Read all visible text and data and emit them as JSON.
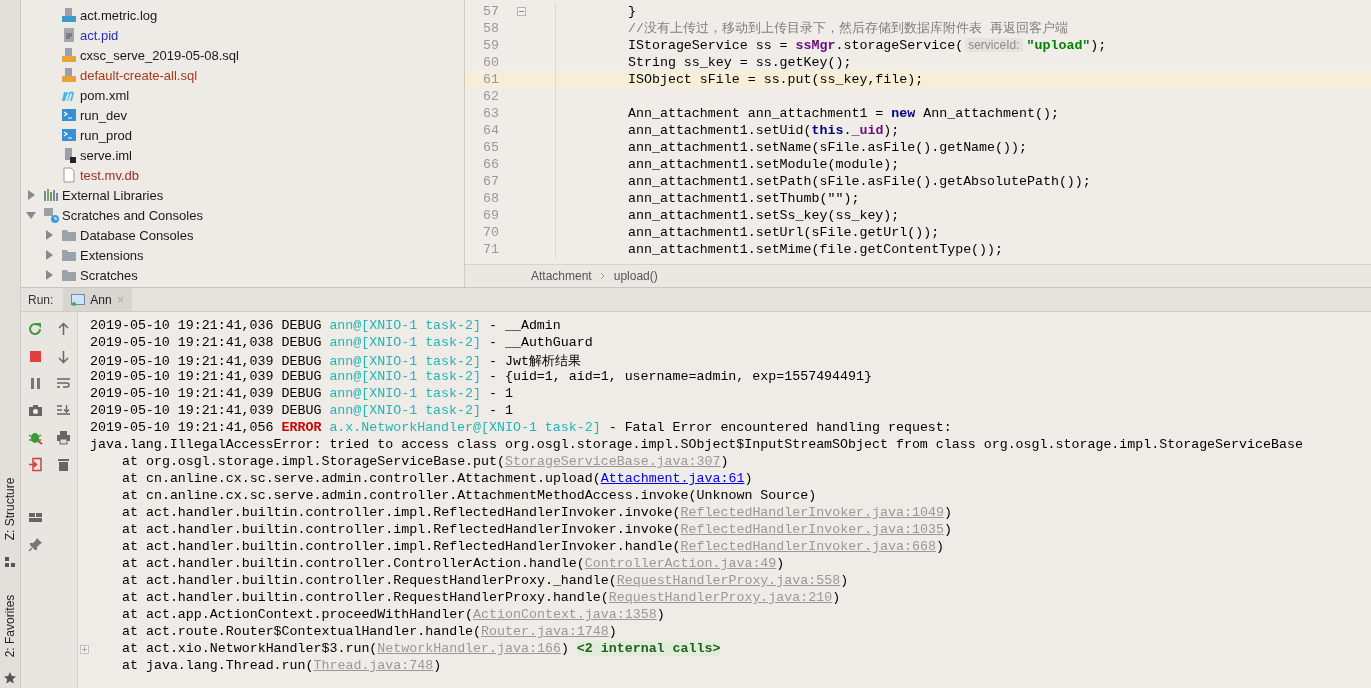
{
  "side_strip": {
    "tabs": [
      {
        "label": "Z: Structure",
        "kind": "structure"
      },
      {
        "label": "2: Favorites",
        "kind": "favorites"
      }
    ]
  },
  "project_tree": {
    "project_files": [
      {
        "label": "act.metric.log",
        "kind": "log",
        "color": "#1a1a1a"
      },
      {
        "label": "act.pid",
        "kind": "text",
        "color": "#2630b8"
      },
      {
        "label": "cxsc_serve_2019-05-08.sql",
        "kind": "sql",
        "color": "#1a1a1a"
      },
      {
        "label": "default-create-all.sql",
        "kind": "sql",
        "color": "#a8391c"
      },
      {
        "label": "pom.xml",
        "kind": "maven",
        "color": "#1a1a1a"
      },
      {
        "label": "run_dev",
        "kind": "shell",
        "color": "#1a1a1a"
      },
      {
        "label": "run_prod",
        "kind": "shell",
        "color": "#1a1a1a"
      },
      {
        "label": "serve.iml",
        "kind": "module",
        "color": "#1a1a1a"
      },
      {
        "label": "test.mv.db",
        "kind": "file",
        "color": "#9c2b2b"
      }
    ],
    "nodes": [
      {
        "label": "External Libraries",
        "kind": "libraries",
        "expanded": false,
        "color": "#1a1a1a"
      },
      {
        "label": "Scratches and Consoles",
        "kind": "scratches",
        "expanded": true,
        "color": "#1a1a1a",
        "children": [
          {
            "label": "Database Consoles",
            "kind": "folder",
            "expanded": false,
            "color": "#1a1a1a"
          },
          {
            "label": "Extensions",
            "kind": "folder",
            "expanded": false,
            "color": "#1a1a1a"
          },
          {
            "label": "Scratches",
            "kind": "folder",
            "expanded": false,
            "color": "#1a1a1a"
          }
        ]
      }
    ]
  },
  "editor": {
    "lines": [
      {
        "number": "57",
        "current": false,
        "fold": true,
        "segments": [
          {
            "text": "}",
            "kind": "plain"
          }
        ]
      },
      {
        "number": "58",
        "current": false,
        "fold": false,
        "segments": [
          {
            "text": "//没有上传过，移动到上传目录下，然后存储到数据库附件表 再返回客户端",
            "kind": "comment"
          }
        ]
      },
      {
        "number": "59",
        "current": false,
        "fold": false,
        "segments": [
          {
            "text": "IStorageService ss = ",
            "kind": "plain"
          },
          {
            "text": "ssMgr",
            "kind": "field"
          },
          {
            "text": ".storageService(",
            "kind": "plain"
          },
          {
            "text": "serviceId:",
            "kind": "hint"
          },
          {
            "text": "\"upload\"",
            "kind": "string"
          },
          {
            "text": ");",
            "kind": "plain"
          }
        ]
      },
      {
        "number": "60",
        "current": false,
        "fold": false,
        "segments": [
          {
            "text": "String ss_key = ss.getKey();",
            "kind": "plain"
          }
        ]
      },
      {
        "number": "61",
        "current": true,
        "fold": false,
        "segments": [
          {
            "text": "ISObject sFile = ss.put(ss_key,file);",
            "kind": "plain"
          }
        ]
      },
      {
        "number": "62",
        "current": false,
        "fold": false
      },
      {
        "number": "63",
        "current": false,
        "fold": false,
        "segments": [
          {
            "text": "Ann_attachment ann_attachment1 = ",
            "kind": "plain"
          },
          {
            "text": "new",
            "kind": "keyword"
          },
          {
            "text": " Ann_attachment();",
            "kind": "plain"
          }
        ]
      },
      {
        "number": "64",
        "current": false,
        "fold": false,
        "segments": [
          {
            "text": "ann_attachment1.setUid(",
            "kind": "plain"
          },
          {
            "text": "this",
            "kind": "keyword"
          },
          {
            "text": ".",
            "kind": "plain"
          },
          {
            "text": "_uid",
            "kind": "field"
          },
          {
            "text": ");",
            "kind": "plain"
          }
        ]
      },
      {
        "number": "65",
        "current": false,
        "fold": false,
        "segments": [
          {
            "text": "ann_attachment1.setName(sFile.asFile().getName());",
            "kind": "plain"
          }
        ]
      },
      {
        "number": "66",
        "current": false,
        "fold": false,
        "segments": [
          {
            "text": "ann_attachment1.setModule(module);",
            "kind": "plain"
          }
        ]
      },
      {
        "number": "67",
        "current": false,
        "fold": false,
        "segments": [
          {
            "text": "ann_attachment1.setPath(sFile.asFile().getAbsolutePath());",
            "kind": "plain"
          }
        ]
      },
      {
        "number": "68",
        "current": false,
        "fold": false,
        "segments": [
          {
            "text": "ann_attachment1.setThumb(\"\");",
            "kind": "plain"
          }
        ]
      },
      {
        "number": "69",
        "current": false,
        "fold": false,
        "segments": [
          {
            "text": "ann_attachment1.setSs_key(ss_key);",
            "kind": "plain"
          }
        ]
      },
      {
        "number": "70",
        "current": false,
        "fold": false,
        "segments": [
          {
            "text": "ann_attachment1.setUrl(sFile.getUrl());",
            "kind": "plain"
          }
        ]
      },
      {
        "number": "71",
        "current": false,
        "fold": false,
        "segments": [
          {
            "text": "ann_attachment1.setMime(file.getContentType());",
            "kind": "plain"
          }
        ]
      }
    ],
    "breadcrumbs": [
      "Attachment",
      "upload()"
    ]
  },
  "run_panel": {
    "label": "Run:",
    "tabs": [
      {
        "label": "Ann",
        "selected": true,
        "close": "×"
      }
    ],
    "console": [
      {
        "kind": "log",
        "segments": [
          {
            "text": "2019-05-10 19:21:41,036 DEBUG ",
            "kind": "plain"
          },
          {
            "text": "ann@[XNIO-1 task-2]",
            "kind": "thread"
          },
          {
            "text": " - __Admin",
            "kind": "plain"
          }
        ]
      },
      {
        "kind": "log",
        "segments": [
          {
            "text": "2019-05-10 19:21:41,038 DEBUG ",
            "kind": "plain"
          },
          {
            "text": "ann@[XNIO-1 task-2]",
            "kind": "thread"
          },
          {
            "text": " - __AuthGuard",
            "kind": "plain"
          }
        ]
      },
      {
        "kind": "log",
        "segments": [
          {
            "text": "2019-05-10 19:21:41,039 DEBUG ",
            "kind": "plain"
          },
          {
            "text": "ann@[XNIO-1 task-2]",
            "kind": "thread"
          },
          {
            "text": " - Jwt解析结果",
            "kind": "plain"
          }
        ]
      },
      {
        "kind": "log",
        "segments": [
          {
            "text": "2019-05-10 19:21:41,039 DEBUG ",
            "kind": "plain"
          },
          {
            "text": "ann@[XNIO-1 task-2]",
            "kind": "thread"
          },
          {
            "text": " - {uid=1, aid=1, username=admin, exp=1557494491}",
            "kind": "plain"
          }
        ]
      },
      {
        "kind": "log",
        "segments": [
          {
            "text": "2019-05-10 19:21:41,039 DEBUG ",
            "kind": "plain"
          },
          {
            "text": "ann@[XNIO-1 task-2]",
            "kind": "thread"
          },
          {
            "text": " - 1",
            "kind": "plain"
          }
        ]
      },
      {
        "kind": "log",
        "segments": [
          {
            "text": "2019-05-10 19:21:41,039 DEBUG ",
            "kind": "plain"
          },
          {
            "text": "ann@[XNIO-1 task-2]",
            "kind": "thread"
          },
          {
            "text": " - 1",
            "kind": "plain"
          }
        ]
      },
      {
        "kind": "log",
        "segments": [
          {
            "text": "2019-05-10 19:21:41,056 ",
            "kind": "plain"
          },
          {
            "text": "ERROR",
            "kind": "error"
          },
          {
            "text": "a.x.NetworkHandler@[XNIO-1 task-2]",
            "kind": "thread"
          },
          {
            "text": " - Fatal Error encountered handling request:",
            "kind": "plain"
          }
        ]
      },
      {
        "kind": "message",
        "segments": [
          {
            "text": "java.lang.IllegalAccessError: tried to access class org.osgl.storage.impl.SObject$InputStreamSObject from class org.osgl.storage.impl.StorageServiceBase",
            "kind": "plain"
          }
        ]
      },
      {
        "kind": "frame",
        "segments": [
          {
            "text": "at org.osgl.storage.impl.StorageServiceBase.put(",
            "kind": "plain"
          },
          {
            "text": "StorageServiceBase.java:307",
            "kind": "link"
          },
          {
            "text": ")",
            "kind": "plain"
          }
        ]
      },
      {
        "kind": "frame",
        "segments": [
          {
            "text": "at cn.anline.cx.sc.serve.admin.controller.Attachment.upload(",
            "kind": "plain"
          },
          {
            "text": "Attachment.java:61",
            "kind": "project_link"
          },
          {
            "text": ")",
            "kind": "plain"
          }
        ]
      },
      {
        "kind": "frame",
        "segments": [
          {
            "text": "at cn.anline.cx.sc.serve.admin.controller.AttachmentMethodAccess.invoke(Unknown Source)",
            "kind": "plain"
          }
        ]
      },
      {
        "kind": "frame",
        "segments": [
          {
            "text": "at act.handler.builtin.controller.impl.ReflectedHandlerInvoker.invoke(",
            "kind": "plain"
          },
          {
            "text": "ReflectedHandlerInvoker.java:1049",
            "kind": "link"
          },
          {
            "text": ")",
            "kind": "plain"
          }
        ]
      },
      {
        "kind": "frame",
        "segments": [
          {
            "text": "at act.handler.builtin.controller.impl.ReflectedHandlerInvoker.invoke(",
            "kind": "plain"
          },
          {
            "text": "ReflectedHandlerInvoker.java:1035",
            "kind": "link"
          },
          {
            "text": ")",
            "kind": "plain"
          }
        ]
      },
      {
        "kind": "frame",
        "segments": [
          {
            "text": "at act.handler.builtin.controller.impl.ReflectedHandlerInvoker.handle(",
            "kind": "plain"
          },
          {
            "text": "ReflectedHandlerInvoker.java:668",
            "kind": "link"
          },
          {
            "text": ")",
            "kind": "plain"
          }
        ]
      },
      {
        "kind": "frame",
        "segments": [
          {
            "text": "at act.handler.builtin.controller.ControllerAction.handle(",
            "kind": "plain"
          },
          {
            "text": "ControllerAction.java:49",
            "kind": "link"
          },
          {
            "text": ")",
            "kind": "plain"
          }
        ]
      },
      {
        "kind": "frame",
        "segments": [
          {
            "text": "at act.handler.builtin.controller.RequestHandlerProxy._handle(",
            "kind": "plain"
          },
          {
            "text": "RequestHandlerProxy.java:558",
            "kind": "link"
          },
          {
            "text": ")",
            "kind": "plain"
          }
        ]
      },
      {
        "kind": "frame",
        "segments": [
          {
            "text": "at act.handler.builtin.controller.RequestHandlerProxy.handle(",
            "kind": "plain"
          },
          {
            "text": "RequestHandlerProxy.java:210",
            "kind": "link"
          },
          {
            "text": ")",
            "kind": "plain"
          }
        ]
      },
      {
        "kind": "frame",
        "segments": [
          {
            "text": "at act.app.ActionContext.proceedWithHandler(",
            "kind": "plain"
          },
          {
            "text": "ActionContext.java:1358",
            "kind": "link"
          },
          {
            "text": ")",
            "kind": "plain"
          }
        ]
      },
      {
        "kind": "frame",
        "segments": [
          {
            "text": "at act.route.Router$ContextualHandler.handle(",
            "kind": "plain"
          },
          {
            "text": "Router.java:1748",
            "kind": "link"
          },
          {
            "text": ")",
            "kind": "plain"
          }
        ]
      },
      {
        "kind": "frame",
        "folded": true,
        "segments": [
          {
            "text": "at act.xio.NetworkHandler$3.run(",
            "kind": "plain"
          },
          {
            "text": "NetworkHandler.java:166",
            "kind": "link"
          },
          {
            "text": ")",
            "kind": "plain"
          },
          {
            "text": "<2 internal calls>",
            "kind": "internal"
          }
        ]
      },
      {
        "kind": "frame",
        "folded": false,
        "segments": [
          {
            "text": "at java.lang.Thread.run(",
            "kind": "plain"
          },
          {
            "text": "Thread.java:748",
            "kind": "link"
          },
          {
            "text": ")",
            "kind": "plain"
          }
        ]
      }
    ]
  }
}
